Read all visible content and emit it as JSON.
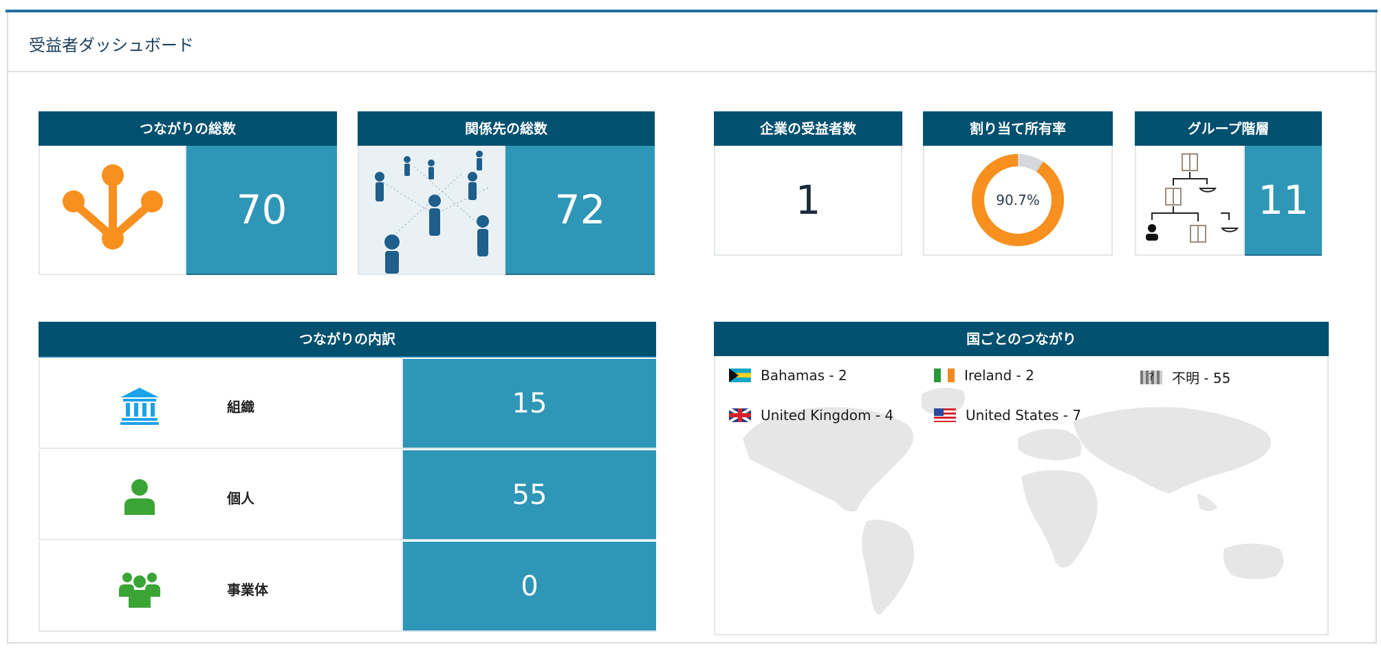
{
  "dashboard": {
    "title": "受益者ダッシュボード"
  },
  "cards": {
    "connections_total": {
      "title": "つながりの総数",
      "value": "70"
    },
    "relations_total": {
      "title": "関係先の総数",
      "value": "72"
    },
    "corp_beneficiaries": {
      "title": "企業の受益者数",
      "value": "1"
    },
    "ownership_rate": {
      "title": "割り当て所有率",
      "value": "90.7%",
      "fraction": 0.907
    },
    "group_hierarchy": {
      "title": "グループ階層",
      "value": "11"
    }
  },
  "breakdown": {
    "title": "つながりの内訳",
    "rows": [
      {
        "label": "組織",
        "value": "15",
        "icon": "bank-icon"
      },
      {
        "label": "個人",
        "value": "55",
        "icon": "person-icon"
      },
      {
        "label": "事業体",
        "value": "0",
        "icon": "group-icon"
      }
    ]
  },
  "countries": {
    "title": "国ごとのつながり",
    "items": [
      {
        "label": "Bahamas - 2",
        "flag": "bahamas-flag-icon"
      },
      {
        "label": "Ireland - 2",
        "flag": "ireland-flag-icon"
      },
      {
        "label": "不明 - 55",
        "flag": "unknown-flag-icon"
      },
      {
        "label": "United Kingdom - 4",
        "flag": "uk-flag-icon"
      },
      {
        "label": "United States - 7",
        "flag": "us-flag-icon"
      }
    ]
  },
  "colors": {
    "header_bg": "#00506f",
    "value_bg": "#2e96b6",
    "accent_orange": "#f7901e",
    "icon_blue": "#1aa3e8",
    "icon_green": "#3aa535"
  }
}
